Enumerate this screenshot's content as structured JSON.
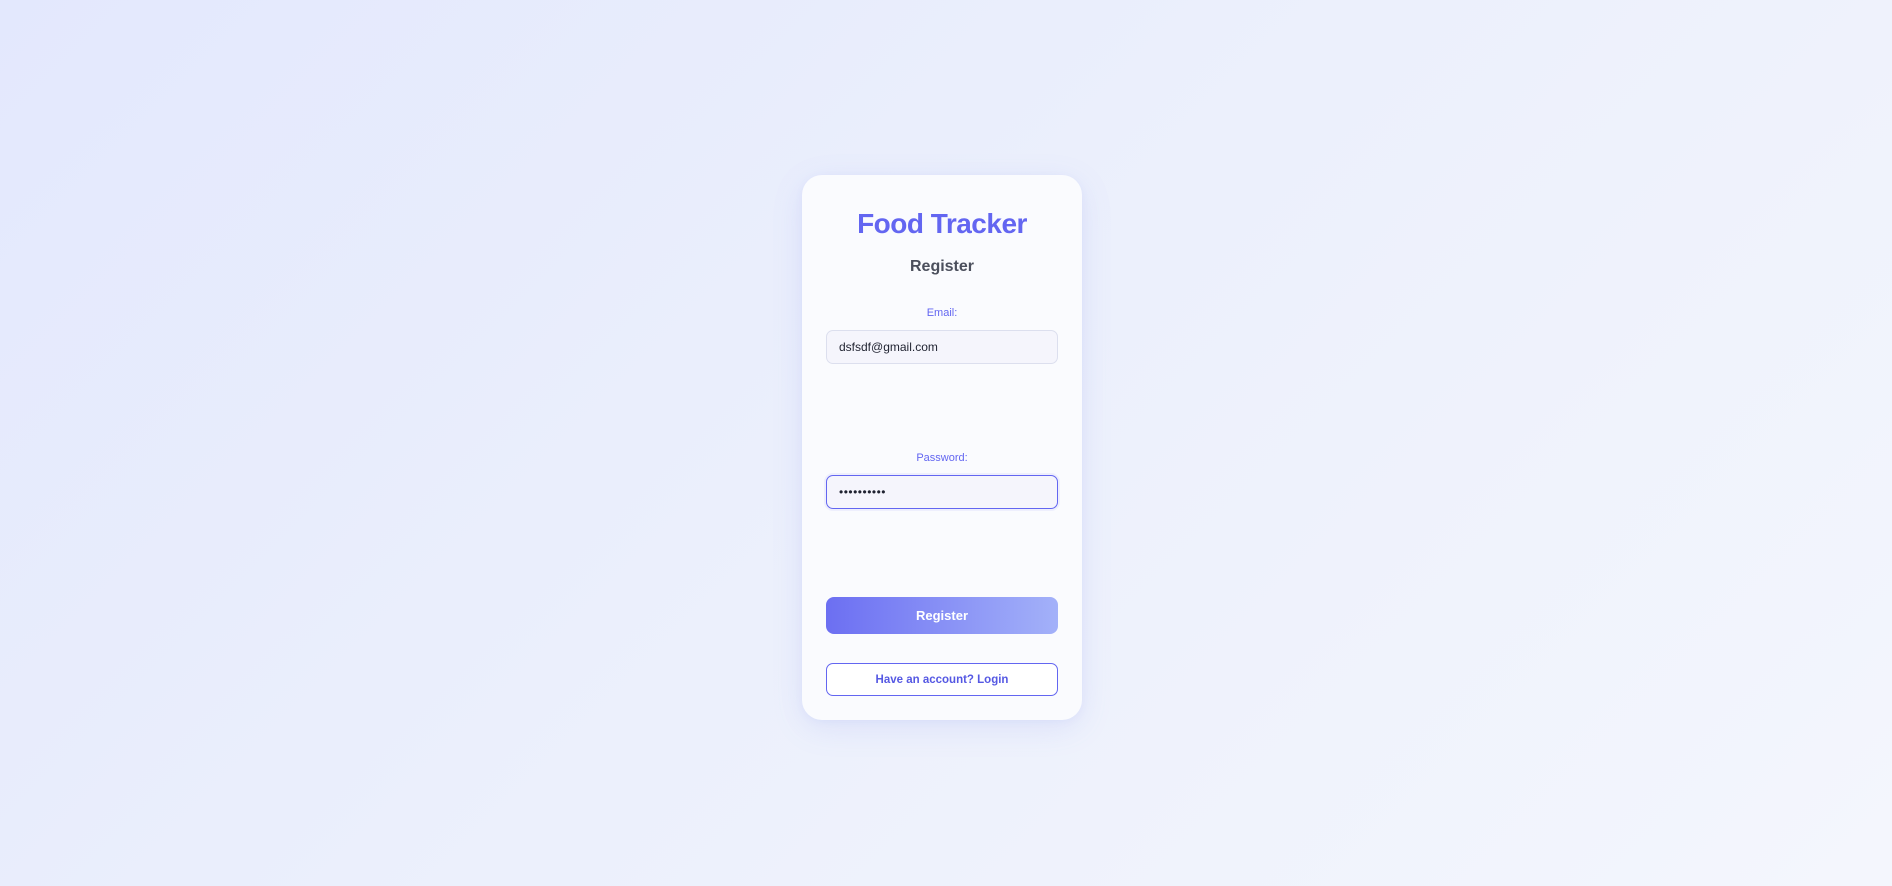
{
  "app": {
    "title": "Food Tracker"
  },
  "form": {
    "title": "Register",
    "email": {
      "label": "Email:",
      "value": "dsfsdf@gmail.com"
    },
    "password": {
      "label": "Password:",
      "value": "••••••••••"
    },
    "submit_label": "Register",
    "login_link_label": "Have an account? Login"
  },
  "colors": {
    "accent": "#6366f1",
    "button_gradient_start": "#6c6ff2",
    "button_gradient_end": "#a3b1f9",
    "card_background": "#fafbfe"
  }
}
